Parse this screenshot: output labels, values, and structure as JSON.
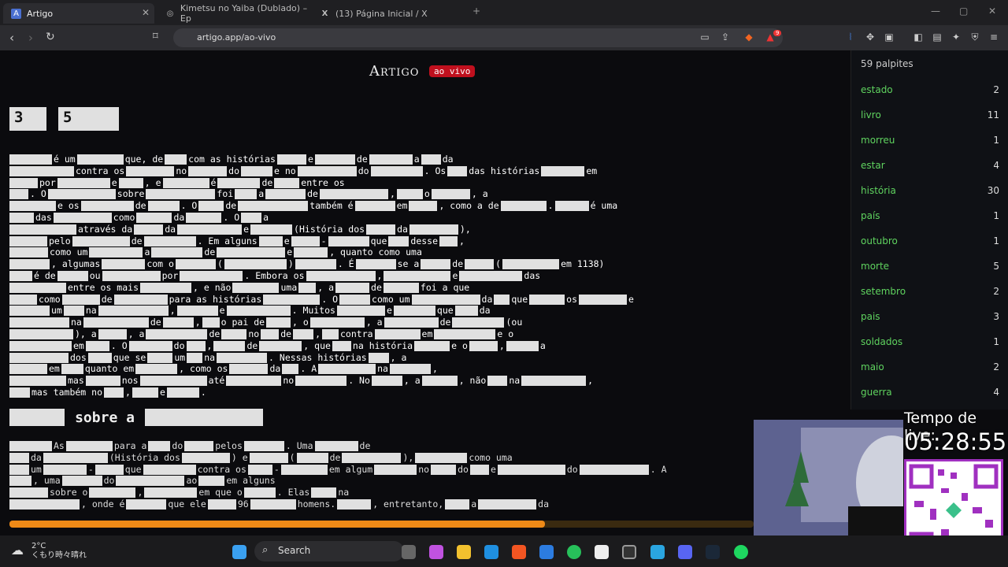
{
  "browser": {
    "tabs": [
      {
        "label": "Artigo",
        "active": true
      },
      {
        "label": "Kimetsu no Yaiba (Dublado) – Ep",
        "active": false
      },
      {
        "label": "(13) Página Inicial / X",
        "active": false
      }
    ],
    "url": "artigo.app/ao-vivo",
    "badge_count": "9"
  },
  "page": {
    "logo": "Artigo",
    "live_badge": "ao vivo",
    "title_boxes": [
      "3",
      "5"
    ],
    "subheading": "sobre a",
    "progress_fraction": 0.72,
    "text_lines": [
      [
        "é um",
        "que, de",
        "com as histórias",
        "e",
        "de",
        "a",
        "da"
      ],
      [
        "contra os",
        "no",
        "do",
        "e no",
        "do",
        ". Os",
        "das histórias",
        "em"
      ],
      [
        "por",
        "e",
        ", e",
        "é",
        "de",
        "entre os"
      ],
      [
        ". O",
        "sobre",
        "foi",
        "a",
        "de",
        ",",
        "o",
        ", a"
      ],
      [
        "e os",
        "de",
        ". O",
        "de",
        "também é",
        "em",
        ", como a de",
        ".",
        "é uma"
      ],
      [
        "das",
        "como",
        "da",
        ". O",
        "a"
      ],
      [
        "através da",
        "da",
        "e",
        "(História dos",
        "da",
        "),"
      ],
      [
        "pelo",
        "de",
        ". Em alguns",
        "e",
        "-",
        "que",
        "desse",
        ","
      ],
      [
        "como um",
        "a",
        "de",
        "e",
        ", quanto como uma"
      ],
      [
        ", algumas",
        "com o",
        "(",
        ")",
        ". É",
        "se a",
        "de",
        "(",
        "em 1138)"
      ],
      [
        "é de",
        "ou",
        "por",
        ". Embora os",
        ",",
        "e",
        "das"
      ],
      [
        "entre os mais",
        ", e não",
        "uma",
        ", a",
        "de",
        "foi a que"
      ],
      [
        "como",
        "de",
        "para as histórias",
        ". O",
        "como um",
        "da",
        "que",
        "os",
        "e"
      ],
      [
        "um",
        "na",
        ",",
        "e",
        ". Muitos",
        "e",
        "que",
        "da"
      ],
      [
        "na",
        "de",
        ",",
        "o pai de",
        ", o",
        ", a",
        "de",
        "(ou"
      ],
      [
        "), a",
        ", a",
        "de",
        "no",
        "de",
        ",",
        "contra",
        "em",
        "e o"
      ],
      [
        "em",
        ". O",
        "do",
        ",",
        "de",
        ", que",
        "na história",
        "e o",
        ",",
        "a"
      ],
      [
        "dos",
        "que se",
        "um",
        "na",
        ". Nessas histórias",
        ", a"
      ],
      [
        "em",
        "quanto em",
        ", como os",
        "da",
        ". A",
        "na",
        ","
      ],
      [
        "mas",
        "nos",
        "até",
        "no",
        ". No",
        ", a",
        ", não",
        "na",
        ","
      ],
      [
        "mas também no",
        ",",
        "e",
        "."
      ]
    ],
    "sub_lines": [
      [
        "As",
        "para a",
        "do",
        "pelos",
        ". Uma",
        "de"
      ],
      [
        "da",
        "(História dos",
        ") e",
        "(",
        "de",
        "),",
        "como uma"
      ],
      [
        "um",
        "-",
        "que",
        "contra os",
        "-",
        "em algum",
        "no",
        "do",
        "e",
        "do",
        ". A"
      ],
      [
        ", uma",
        "do",
        "ao",
        "em alguns"
      ],
      [
        "sobre o",
        ",",
        "em que o",
        ". Elas",
        "na"
      ],
      [
        ", onde é",
        "que ele",
        "96",
        "homens.",
        ", entretanto,",
        "a",
        "da"
      ]
    ]
  },
  "sidebar": {
    "header": "59 palpites",
    "guesses": [
      {
        "word": "estado",
        "count": "2"
      },
      {
        "word": "livro",
        "count": "11"
      },
      {
        "word": "morreu",
        "count": "1"
      },
      {
        "word": "estar",
        "count": "4"
      },
      {
        "word": "história",
        "count": "30"
      },
      {
        "word": "país",
        "count": "1"
      },
      {
        "word": "outubro",
        "count": "1"
      },
      {
        "word": "morte",
        "count": "5"
      },
      {
        "word": "setembro",
        "count": "2"
      },
      {
        "word": "pais",
        "count": "3"
      },
      {
        "word": "soldados",
        "count": "1"
      },
      {
        "word": "maio",
        "count": "2"
      },
      {
        "word": "guerra",
        "count": "4"
      }
    ]
  },
  "overlay": {
    "timer_label": "Tempo de live:",
    "timer_value": "05:28:55"
  },
  "taskbar": {
    "temperature": "2°C",
    "weather": "くもり時々晴れ",
    "search_label": "Search"
  }
}
